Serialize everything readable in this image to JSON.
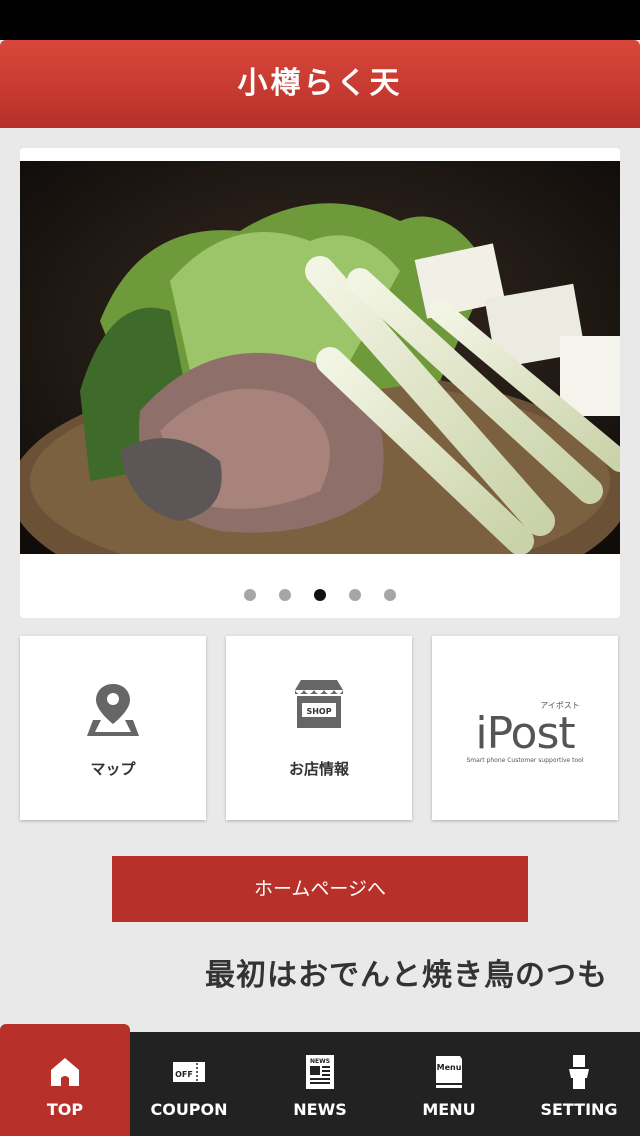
{
  "header": {
    "title": "小樽らく天"
  },
  "slider": {
    "image": "food-photo",
    "dots_total": 5,
    "active_dot": 3
  },
  "tiles": [
    {
      "label": "マップ",
      "icon": "map-pin-icon"
    },
    {
      "label": "お店情報",
      "icon": "shop-icon",
      "icon_text": "SHOP"
    },
    {
      "logo_main": "iPost",
      "logo_kana": "アイポスト",
      "logo_tagline": "Smart phone  Customer supportive tool",
      "icon": "ipost-logo"
    }
  ],
  "homepage_button": {
    "label": "ホームページへ"
  },
  "ticker": {
    "text": "最初はおでんと焼き鳥のつも"
  },
  "tabbar": {
    "items": [
      {
        "label": "TOP",
        "icon": "home-icon",
        "active": true
      },
      {
        "label": "COUPON",
        "icon": "coupon-icon",
        "icon_text": "OFF"
      },
      {
        "label": "NEWS",
        "icon": "newspaper-icon",
        "icon_text": "NEWS"
      },
      {
        "label": "MENU",
        "icon": "menu-book-icon",
        "icon_text": "Menu"
      },
      {
        "label": "SETTING",
        "icon": "person-icon"
      }
    ]
  },
  "colors": {
    "brand_red": "#b8302a",
    "tabbar_bg": "#222222",
    "background": "#e9e9e9"
  }
}
